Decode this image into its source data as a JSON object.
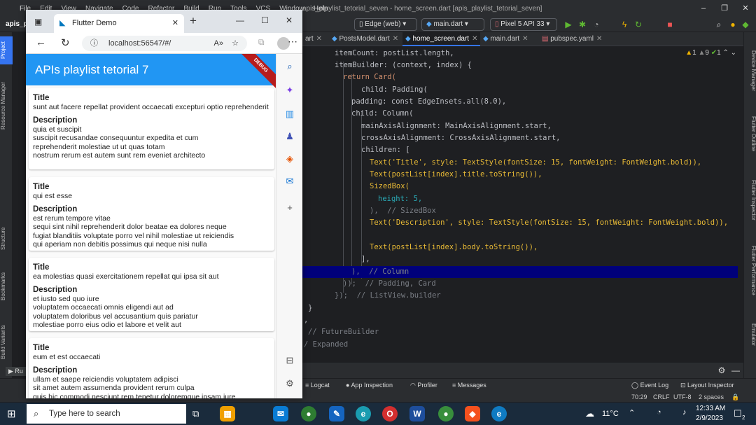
{
  "ide": {
    "app_short": "apis_p",
    "menu": [
      "File",
      "Edit",
      "View",
      "Navigate",
      "Code",
      "Refactor",
      "Build",
      "Run",
      "Tools",
      "VCS",
      "Window",
      "Help"
    ],
    "window_title": "apis_playlist_tetorial_seven - home_screen.dart [apis_playlist_tetorial_seven]",
    "device_select": "Edge (web)",
    "run_config": "main.dart",
    "emulator": "Pixel 5 API 33",
    "left_tools": [
      "Project",
      "Resource Manager",
      "Structure",
      "Bookmarks",
      "Build Variants"
    ],
    "right_tools": [
      "Device Manager",
      "Flutter Outline",
      "Flutter Inspector",
      "Flutter Performance",
      "Emulator"
    ],
    "tabs": [
      {
        "label": "art"
      },
      {
        "label": "PostsModel.dart"
      },
      {
        "label": "home_screen.dart"
      },
      {
        "label": "main.dart"
      },
      {
        "label": "pubspec.yaml"
      }
    ],
    "inspection": {
      "warnings": "1",
      "weak": "9",
      "ok": "1"
    },
    "run_label": "Ru",
    "bottom_tools": [
      "Logcat",
      "App Inspection",
      "Profiler",
      "Messages"
    ],
    "bottom_right_tools": [
      "Event Log",
      "Layout Inspector"
    ],
    "status": {
      "position": "70:29",
      "line_sep": "CRLF",
      "encoding": "UTF-8",
      "indent": "2 spaces"
    }
  },
  "browser": {
    "tab_title": "Flutter Demo",
    "url": "localhost:56547/#/",
    "debug_banner": "DEBUG",
    "app_title": "APIs playlist tetorial 7",
    "cards": [
      {
        "title_label": "Title",
        "title": "sunt aut facere repellat provident occaecati excepturi optio reprehenderit",
        "desc_label": "Description",
        "body": "quia et suscipit\nsuscipit recusandae consequuntur expedita et cum\nreprehenderit molestiae ut ut quas totam\nnostrum rerum est autem sunt rem eveniet architecto"
      },
      {
        "title_label": "Title",
        "title": "qui est esse",
        "desc_label": "Description",
        "body": "est rerum tempore vitae\nsequi sint nihil reprehenderit dolor beatae ea dolores neque\nfugiat blanditiis voluptate porro vel nihil molestiae ut reiciendis\nqui aperiam non debitis possimus qui neque nisi nulla"
      },
      {
        "title_label": "Title",
        "title": "ea molestias quasi exercitationem repellat qui ipsa sit aut",
        "desc_label": "Description",
        "body": "et iusto sed quo iure\nvoluptatem occaecati omnis eligendi aut ad\nvoluptatem doloribus vel accusantium quis pariatur\nmolestiae porro eius odio et labore et velit aut"
      },
      {
        "title_label": "Title",
        "title": "eum et est occaecati",
        "desc_label": "Description",
        "body": "ullam et saepe reiciendis voluptatem adipisci\nsit amet autem assumenda provident rerum culpa\nquis hic commodi nesciunt rem tenetur doloremque ipsam iure"
      }
    ]
  },
  "taskbar": {
    "search_placeholder": "Type here to search",
    "temperature": "11°C",
    "time": "12:33 AM",
    "date": "2/9/2023",
    "notifications": "2"
  },
  "code_lines": [
    "itemCount: postList.length,",
    "itemBuilder: (context, index) {",
    "return Card(",
    "child: Padding(",
    "padding: const EdgeInsets.all(8.0),",
    "child: Column(",
    "mainAxisAlignment: MainAxisAlignment.start,",
    "crossAxisAlignment: CrossAxisAlignment.start,",
    "children: [",
    "Text('Title', style: TextStyle(fontSize: 15, fontWeight: FontWeight.bold)),",
    "Text(postList[index].title.toString()),",
    "SizedBox(",
    "height: 5,",
    "),  // SizedBox",
    "Text('Description', style: TextStyle(fontSize: 15, fontWeight: FontWeight.bold)),",
    "",
    "Text(postList[index].body.toString()),",
    "],",
    "),  // Column",
    "));  // Padding, Card",
    "});  // ListView.builder",
    "}",
    ",",
    "// FutureBuilder",
    "/ Expanded"
  ],
  "colors": {
    "accent": "#2196f3",
    "debug": "#b71c1c",
    "ide_bg": "#1e1f22"
  }
}
